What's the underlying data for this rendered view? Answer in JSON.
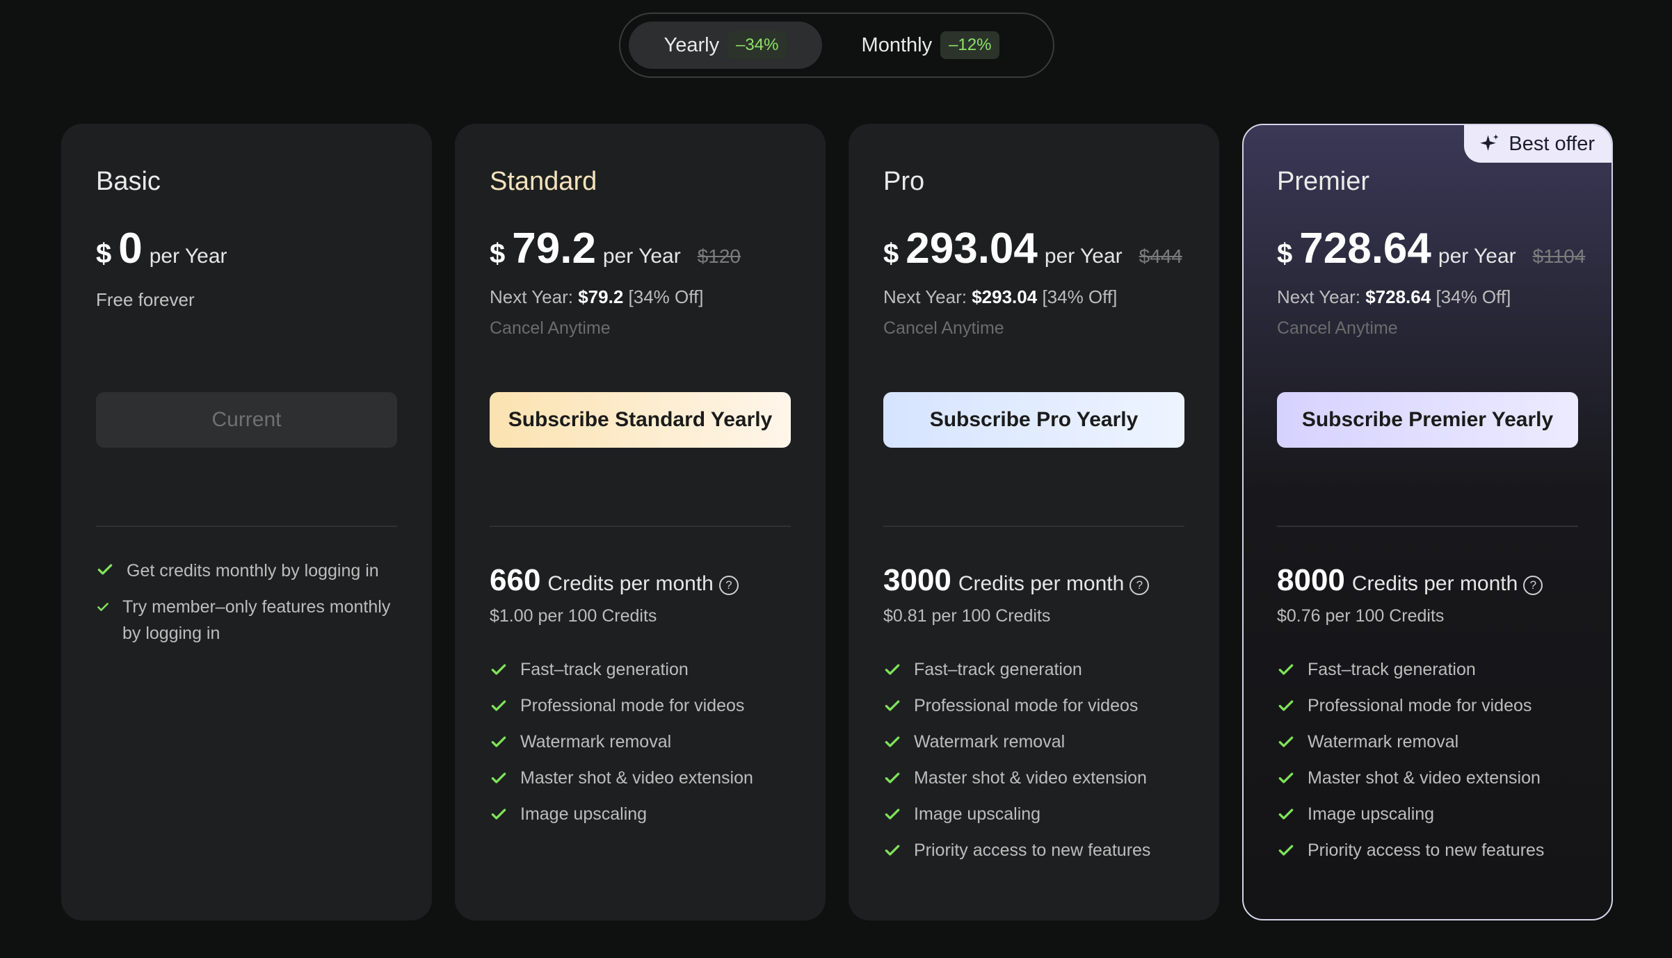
{
  "billing_toggle": {
    "yearly": {
      "label": "Yearly",
      "discount": "–34%"
    },
    "monthly": {
      "label": "Monthly",
      "discount": "–12%"
    },
    "selected": "yearly"
  },
  "colors": {
    "accent_check": "#7ee35a",
    "background": "#0f1010",
    "card": "#1e1f20"
  },
  "plans": [
    {
      "name": "Basic",
      "currency": "$",
      "price": "0",
      "period": "per Year",
      "subtitle": "Free forever",
      "button": "Current",
      "features": [
        "Get credits monthly by logging in",
        "Try member–only features monthly by logging in"
      ]
    },
    {
      "name": "Standard",
      "currency": "$",
      "price": "79.2",
      "period": "per Year",
      "original_price": "$120",
      "next_year_label": "Next Year:",
      "next_year_price": "$79.2",
      "next_year_discount": "[34% Off]",
      "cancel": "Cancel Anytime",
      "button": "Subscribe Standard Yearly",
      "credits": "660",
      "credits_label": "Credits per month",
      "unit_price": "$1.00 per 100 Credits",
      "features": [
        "Fast–track generation",
        "Professional mode for videos",
        "Watermark removal",
        "Master shot & video extension",
        "Image upscaling"
      ]
    },
    {
      "name": "Pro",
      "currency": "$",
      "price": "293.04",
      "period": "per Year",
      "original_price": "$444",
      "next_year_label": "Next Year:",
      "next_year_price": "$293.04",
      "next_year_discount": "[34% Off]",
      "cancel": "Cancel Anytime",
      "button": "Subscribe Pro Yearly",
      "credits": "3000",
      "credits_label": "Credits per month",
      "unit_price": "$0.81 per 100 Credits",
      "features": [
        "Fast–track generation",
        "Professional mode for videos",
        "Watermark removal",
        "Master shot & video extension",
        "Image upscaling",
        "Priority access to new features"
      ]
    },
    {
      "name": "Premier",
      "badge": "Best offer",
      "currency": "$",
      "price": "728.64",
      "period": "per Year",
      "original_price": "$1104",
      "next_year_label": "Next Year:",
      "next_year_price": "$728.64",
      "next_year_discount": "[34% Off]",
      "cancel": "Cancel Anytime",
      "button": "Subscribe Premier Yearly",
      "credits": "8000",
      "credits_label": "Credits per month",
      "unit_price": "$0.76 per 100 Credits",
      "features": [
        "Fast–track generation",
        "Professional mode for videos",
        "Watermark removal",
        "Master shot & video extension",
        "Image upscaling",
        "Priority access to new features"
      ]
    }
  ]
}
